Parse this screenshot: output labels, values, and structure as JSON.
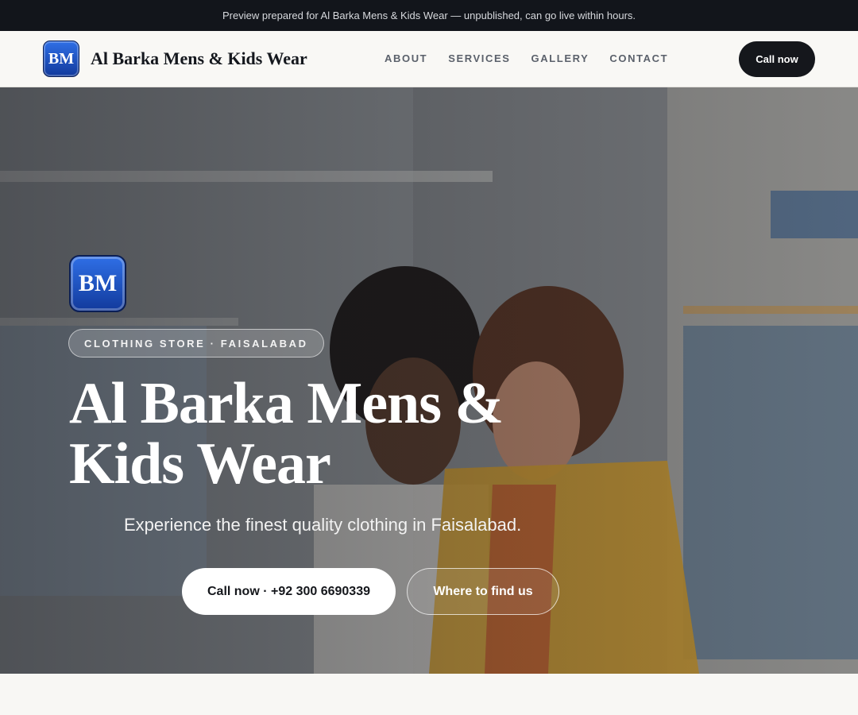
{
  "topbar": {
    "text": "Preview prepared for Al Barka Mens & Kids Wear — unpublished, can go live within hours."
  },
  "nav": {
    "logo_text": "BM",
    "brand": "Al Barka Mens & Kids Wear",
    "links": [
      {
        "label": "ABOUT"
      },
      {
        "label": "SERVICES"
      },
      {
        "label": "GALLERY"
      },
      {
        "label": "CONTACT"
      }
    ],
    "cta": "Call now"
  },
  "hero": {
    "logo_text": "BM",
    "tag": "CLOTHING STORE · FAISALABAD",
    "title": "Al Barka Mens & Kids Wear",
    "subtitle": "Experience the finest quality clothing in Faisalabad.",
    "primary_button": "Call now · +92 300 6690339",
    "secondary_button": "Where to find us",
    "background_image": "clothing-store-photo"
  },
  "colors": {
    "topbar_bg": "#12151b",
    "brand_blue": "#1f55c8",
    "dark_button": "#15171c",
    "page_bg": "#f8f7f4"
  }
}
